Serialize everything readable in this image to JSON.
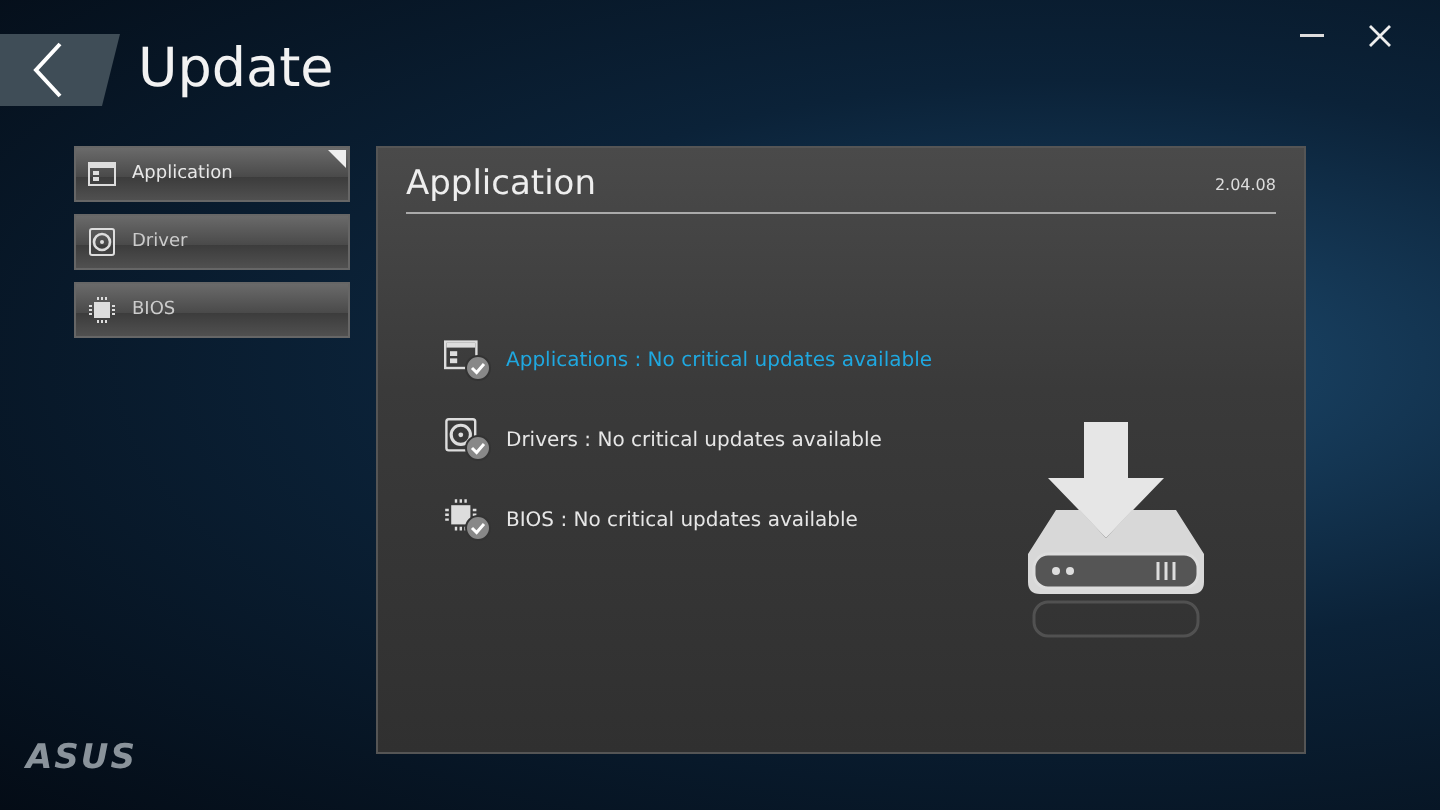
{
  "window": {
    "title": "Update"
  },
  "sidebar": {
    "items": [
      {
        "label": "Application",
        "kind": "application",
        "selected": true
      },
      {
        "label": "Driver",
        "kind": "driver",
        "selected": false
      },
      {
        "label": "BIOS",
        "kind": "bios",
        "selected": false
      }
    ]
  },
  "panel": {
    "title": "Application",
    "version": "2.04.08",
    "statuses": [
      {
        "text": "Applications : No critical updates available",
        "kind": "application",
        "selected": true
      },
      {
        "text": "Drivers : No critical updates available",
        "kind": "driver",
        "selected": false
      },
      {
        "text": "BIOS : No critical updates available",
        "kind": "bios",
        "selected": false
      }
    ]
  },
  "logo": "ASUS"
}
